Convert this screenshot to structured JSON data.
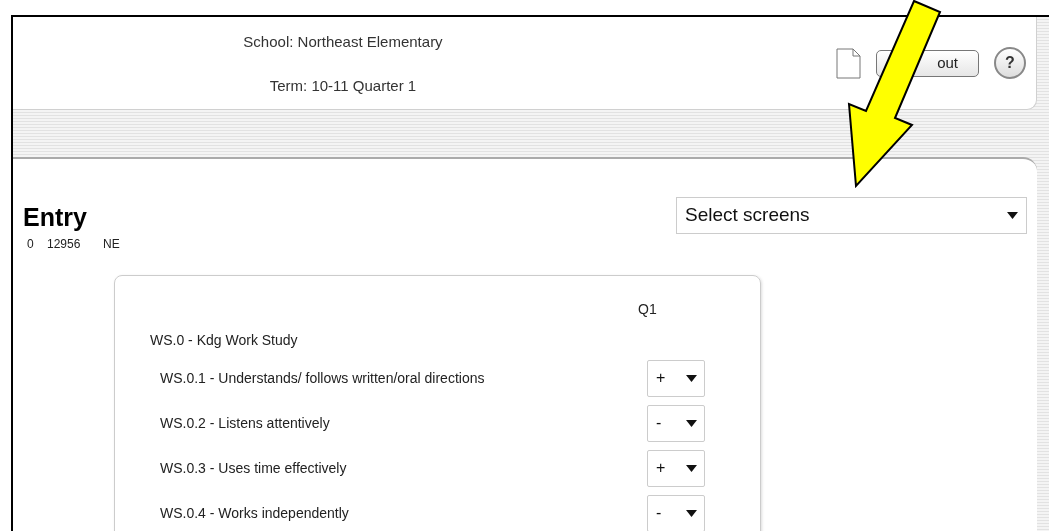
{
  "header": {
    "school": "School: Northeast Elementary",
    "term": "Term: 10-11 Quarter 1",
    "logout_button": "out",
    "help_button": "?"
  },
  "page": {
    "title": "Entry",
    "student_info": [
      "0",
      "12956",
      "NE"
    ],
    "screen_select": "Select screens"
  },
  "grades": {
    "column": "Q1",
    "group": "WS.0 - Kdg Work Study",
    "items": [
      {
        "label": "WS.0.1 - Understands/ follows written/oral directions",
        "value": "+"
      },
      {
        "label": "WS.0.2 - Listens attentively",
        "value": "-"
      },
      {
        "label": "WS.0.3 - Uses time effectively",
        "value": "+"
      },
      {
        "label": "WS.0.4 - Works independently",
        "value": "-"
      }
    ]
  }
}
